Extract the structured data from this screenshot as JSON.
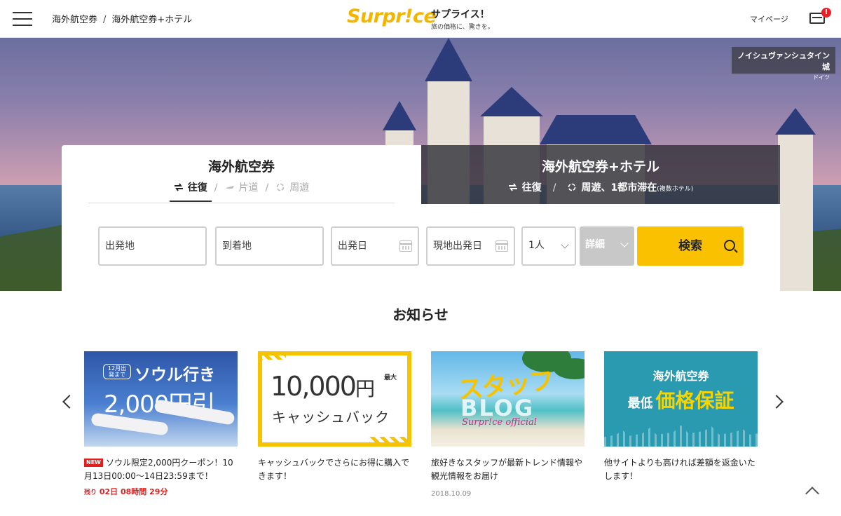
{
  "header": {
    "breadcrumbs": [
      "海外航空券",
      "海外航空券+ホテル"
    ],
    "breadcrumb_sep": "/",
    "logo_word": "Surpr!ce",
    "logo_jp": "サプライス！",
    "logo_tagline": "旅の価格に、驚きを。",
    "mypage_label": "マイページ",
    "cart_badge": "!"
  },
  "hero": {
    "caption_title": "ノイシュヴァンシュタイン城",
    "caption_country": "ドイツ"
  },
  "search": {
    "tab_air": {
      "title": "海外航空券",
      "trip_types": [
        "往復",
        "片道",
        "周遊"
      ],
      "separator": "/"
    },
    "tab_hotel": {
      "title": "海外航空券+ホテル",
      "trip_types": [
        "往復",
        "周遊、1都市滞在"
      ],
      "trip_suffix": "(複数ホテル)",
      "separator": "/"
    },
    "fields": {
      "origin_placeholder": "出発地",
      "destination_placeholder": "到着地",
      "depart_date_placeholder": "出発日",
      "local_depart_placeholder": "現地出発日",
      "passengers_value": "1人",
      "detail_label": "詳細",
      "search_label": "検索"
    }
  },
  "news": {
    "title": "お知らせ",
    "cards": [
      {
        "img_pill": "12月出発まで",
        "img_h1": "ソウル行き",
        "img_h2": "2,000円引",
        "badge": "NEW",
        "text": "ソウル限定2,000円クーポン！10月13日00:00～14日23:59まで！",
        "remain_prefix": "残り",
        "remain_value": "02日 08時間 29分"
      },
      {
        "img_big": "10,000",
        "img_yen": "円",
        "img_max": "最大",
        "img_cb": "キャッシュバック",
        "text": "キャッシュバックでさらにお得に購入できます！"
      },
      {
        "img_s1": "スタッフ",
        "img_s2": "BLOG",
        "img_s3": "Surpr!ce official",
        "text": "旅好きなスタッフが最新トレンド情報や観光情報をお届け",
        "date": "2018.10.09"
      },
      {
        "img_t1": "海外航空券",
        "img_low": "最低",
        "img_t2": "価格保証",
        "text": "他サイトよりも高ければ差額を返金いたします！"
      }
    ]
  },
  "colors": {
    "accent": "#fac100",
    "badge_red": "#e8202a",
    "tab_dark": "#32323a"
  }
}
